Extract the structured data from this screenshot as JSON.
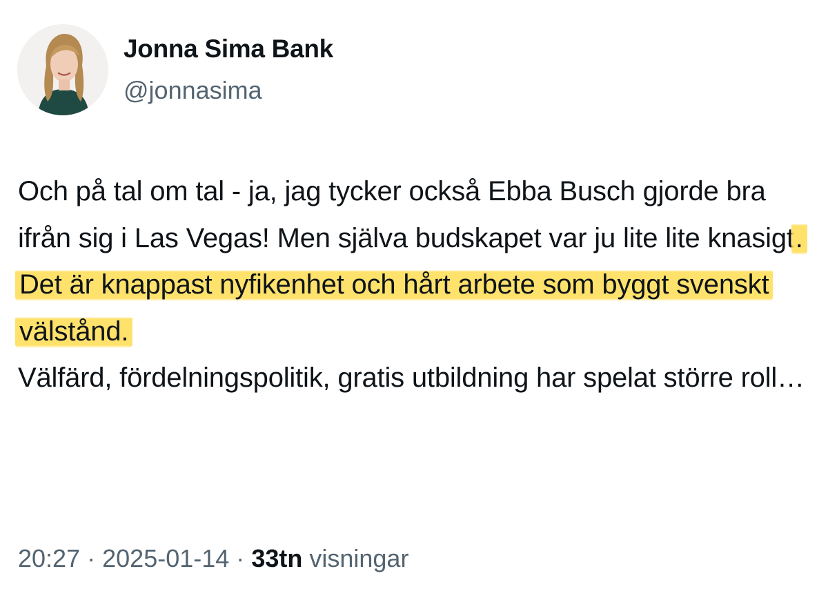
{
  "author": {
    "name": "Jonna Sima Bank",
    "handle": "@jonnasima",
    "avatar_icon": "profile-photo"
  },
  "tweet": {
    "text_before_highlight": "Och på tal om tal - ja, jag tycker också Ebba Busch gjorde bra ifrån sig i Las Vegas! Men själva budskapet var ju lite lite knasigt",
    "text_highlight": ". Det är knappast nyfikenhet och hårt arbete som byggt svenskt välstånd.",
    "text_after": "Välfärd, fördelningspolitik, gratis utbildning har spelat större roll…",
    "highlight_color": "#ffdd52"
  },
  "meta": {
    "time": "20:27",
    "separator": "·",
    "date": "2025-01-14",
    "views_count": "33tn",
    "views_label": "visningar"
  },
  "colors": {
    "text": "#0f1419",
    "secondary": "#536471",
    "background": "#ffffff"
  }
}
